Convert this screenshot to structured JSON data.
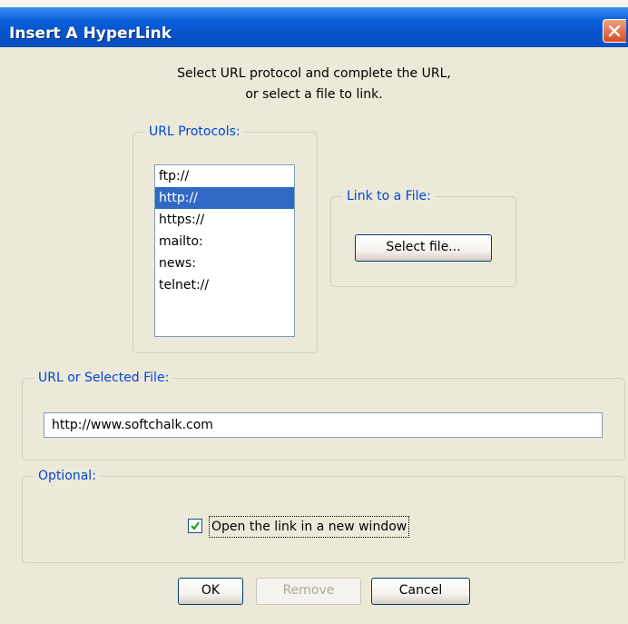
{
  "dialog": {
    "title": "Insert A HyperLink",
    "intro_line1": "Select URL protocol and complete the URL,",
    "intro_line2": "or select a file to link."
  },
  "url_protocols": {
    "legend": "URL Protocols:",
    "items": [
      "ftp://",
      "http://",
      "https://",
      "mailto:",
      "news:",
      "telnet://"
    ],
    "selected": "http://"
  },
  "link_file": {
    "legend": "Link to a File:",
    "select_button": "Select file..."
  },
  "url_field": {
    "legend": "URL or Selected File:",
    "value": "http://www.softchalk.com"
  },
  "optional": {
    "legend": "Optional:",
    "checkbox_label": "Open the link in a new window",
    "checked": true
  },
  "buttons": {
    "ok": "OK",
    "remove": "Remove",
    "cancel": "Cancel"
  },
  "colors": {
    "titlebar": "#0a5fd8",
    "accent": "#0046d5",
    "selection": "#316ac5",
    "dialog_bg": "#ece9d8"
  }
}
